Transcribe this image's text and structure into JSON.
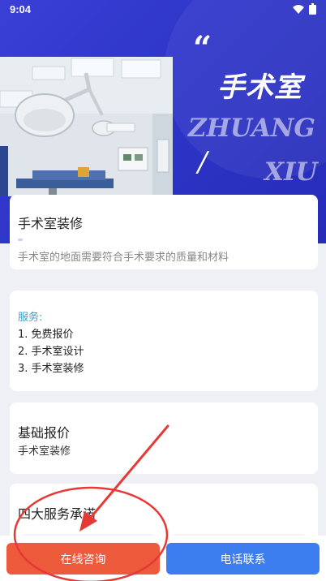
{
  "status_bar": {
    "time": "9:04"
  },
  "hero": {
    "quote": "“",
    "title": "手术室",
    "subtitle_line1": "ZHUANG",
    "slash": "/",
    "subtitle_line2": "XIU"
  },
  "card1": {
    "title": "手术室装修",
    "description": "手术室的地面需要符合手术要求的质量和材料"
  },
  "card2": {
    "label": "服务:",
    "items": [
      "1. 免费报价",
      "2. 手术室设计",
      "3. 手术室装修"
    ]
  },
  "card3": {
    "title": "基础报价",
    "subtitle": "手术室装修"
  },
  "card4": {
    "title": "四大服务承诺"
  },
  "bottom_bar": {
    "left_button": "在线咨询",
    "right_button": "电话联系"
  },
  "colors": {
    "hero_blue": "#2f36c9",
    "consult_button": "#ee5a3c",
    "call_button": "#3c7df0",
    "annotation_red": "#e53935",
    "service_label": "#3aa0c8"
  }
}
